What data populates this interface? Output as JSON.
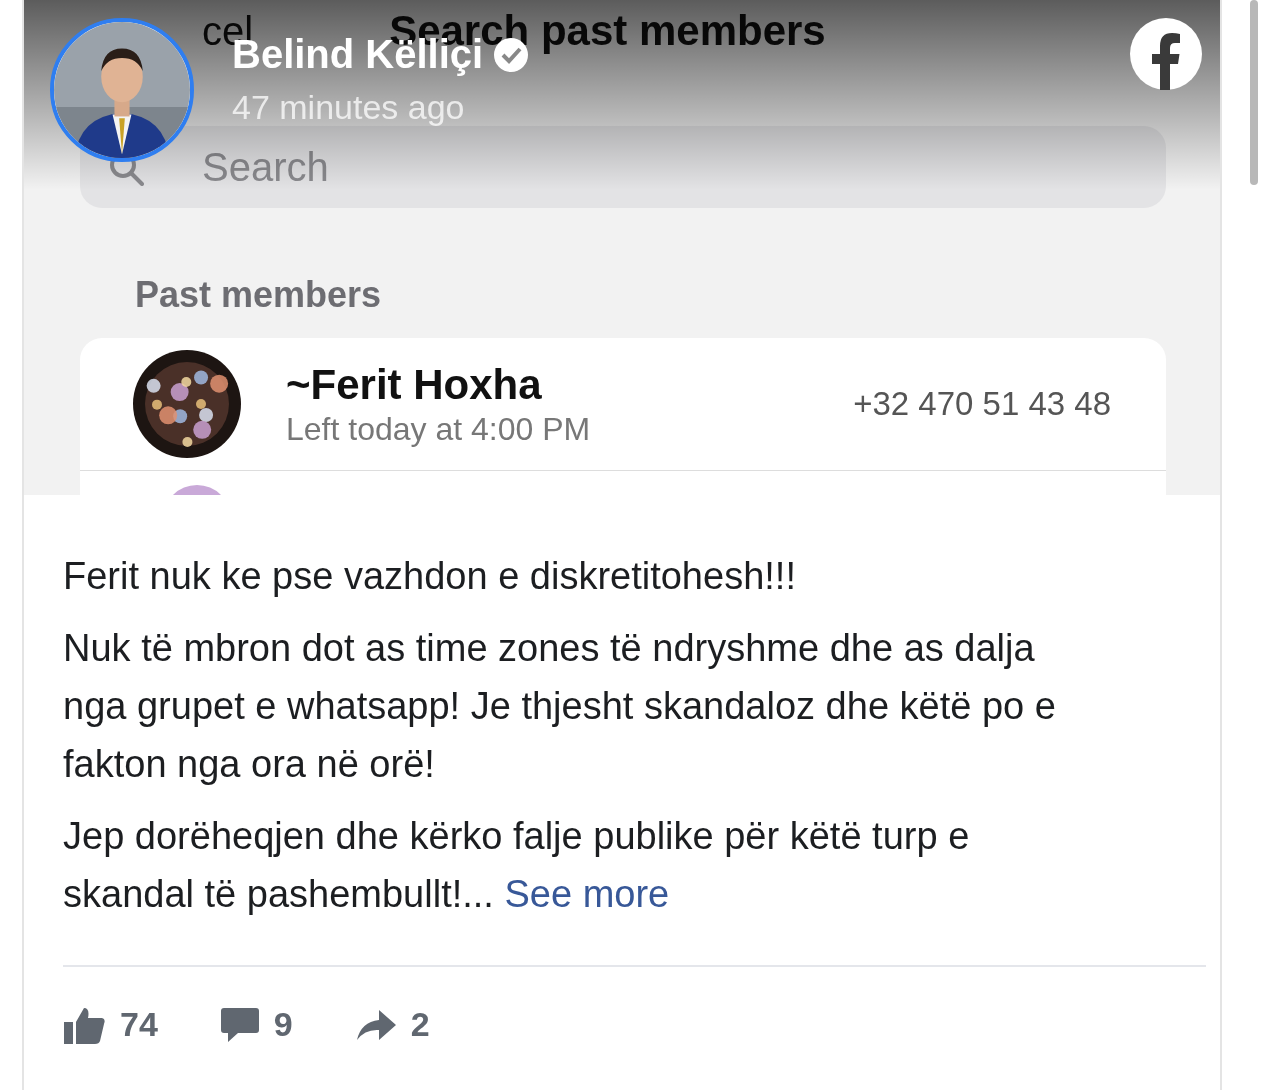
{
  "screenshot": {
    "cancel": "cel",
    "title": "Search past members",
    "search": {
      "placeholder": "Search"
    },
    "section": "Past members",
    "members": [
      {
        "name": "~Ferit Hoxha",
        "status": "Left today at 4:00 PM",
        "phone": "+32 470 51 43 48"
      }
    ]
  },
  "post": {
    "author": "Belind Këlliçi",
    "verified": true,
    "time": "47 minutes ago",
    "paragraphs": [
      "Ferit nuk ke pse vazhdon e diskretitohesh!!!",
      "Nuk të mbron dot as time zones të ndryshme dhe as dalja nga grupet e whatsapp! Je thjesht skandaloz dhe këtë po e fakton nga ora në orë!",
      "Jep dorëheqjen dhe kërko falje publike për këtë turp e skandal të pashembullt!..."
    ],
    "see_more": "See more",
    "likes": "74",
    "comments": "9",
    "shares": "2"
  }
}
